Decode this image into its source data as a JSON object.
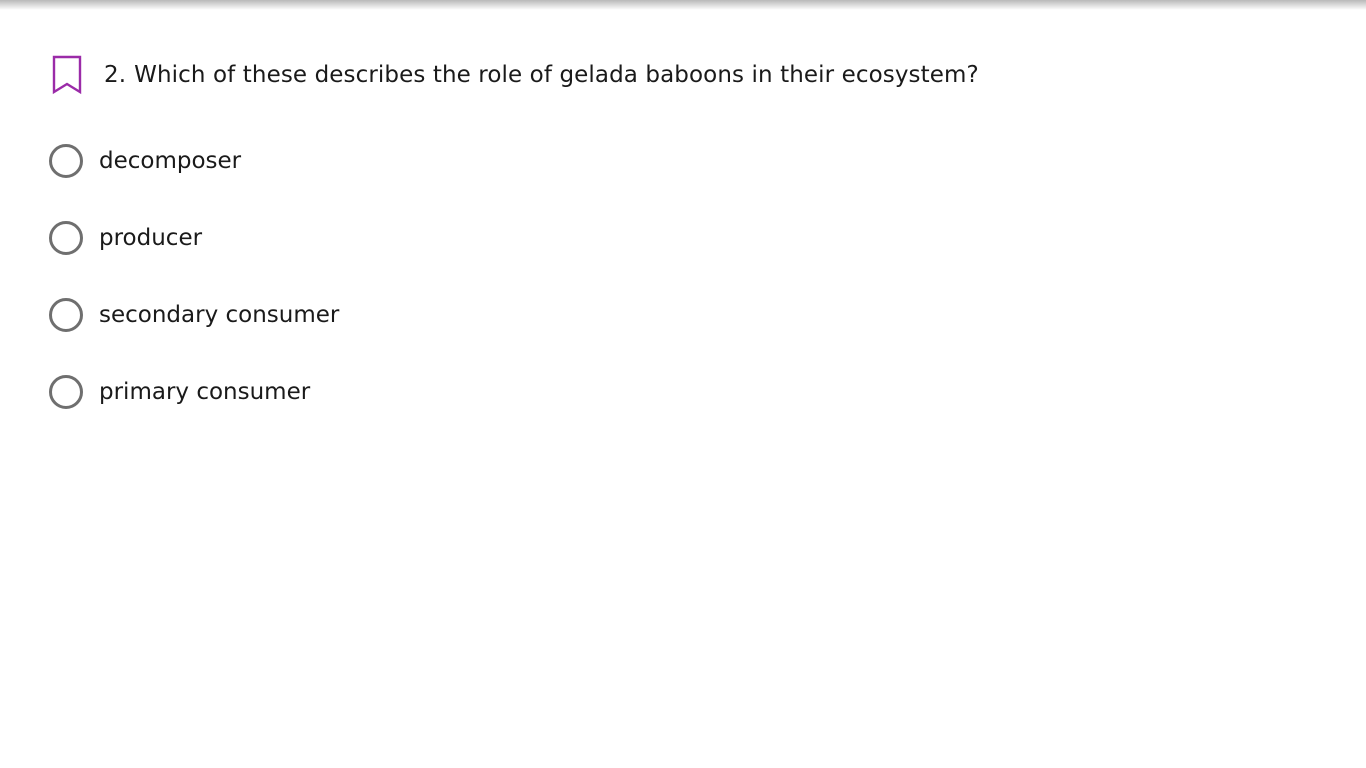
{
  "question": {
    "number": "2.",
    "text": "Which of these describes the role of gelada baboons in their ecosystem?",
    "bookmark_icon": "bookmark-icon"
  },
  "options": [
    {
      "label": "decomposer"
    },
    {
      "label": "producer"
    },
    {
      "label": "secondary consumer"
    },
    {
      "label": "primary consumer"
    }
  ],
  "colors": {
    "bookmark": "#9b2ba8",
    "radio_border": "#6f6f6f",
    "text": "#1a1a1a"
  }
}
